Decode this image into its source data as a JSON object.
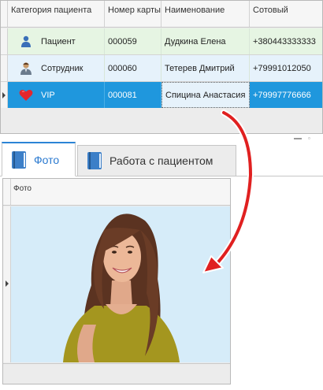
{
  "grid": {
    "columns": [
      "Категория пациента",
      "Номер карты",
      "Наименование",
      "Сотовый"
    ],
    "rows": [
      {
        "category": "Пациент",
        "card": "000059",
        "name": "Дудкина Елена",
        "phone": "+380443333333",
        "icon": "patient-person-icon"
      },
      {
        "category": "Сотрудник",
        "card": "000060",
        "name": "Тетерев Дмитрий",
        "phone": "+79991012050",
        "icon": "employee-person-icon"
      },
      {
        "category": "VIP",
        "card": "000081",
        "name": "Спицина Анастасия",
        "phone": "+79997776666",
        "icon": "heart-icon"
      }
    ]
  },
  "tabs": [
    {
      "label": "Фото",
      "icon": "book-icon"
    },
    {
      "label": "Работа с пациентом",
      "icon": "book-icon"
    }
  ],
  "photo_grid": {
    "column": "Фото"
  },
  "colors": {
    "patient_row": "#e6f5e3",
    "employee_row": "#e6f2fb",
    "vip_row_selected": "#1f97dd",
    "active_tab_accent": "#2b84d6",
    "arrow": "#e02020"
  }
}
